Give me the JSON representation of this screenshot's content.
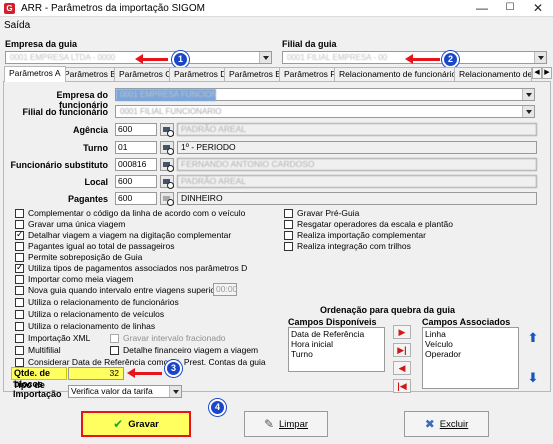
{
  "window": {
    "title": "ARR - Parâmetros da importação  SIGOM",
    "app_icon": "G",
    "minimize": "—",
    "maximize": "☐",
    "close": "✕"
  },
  "menu": {
    "item": "Saída"
  },
  "header": {
    "empresa_label": "Empresa da guia",
    "empresa_value": "0001 EMPRESA LTDA - 0000",
    "filial_label": "Filial  da guia",
    "filial_value": "0001 FILIAL EMPRESA - 00"
  },
  "tabs": [
    "Parâmetros A",
    "Parâmetros B",
    "Parâmetros C",
    "Parâmetros D",
    "Parâmetros E",
    "Parâmetros F",
    "Relacionamento de funcionários",
    "Relacionamento de v"
  ],
  "tab_scroll": {
    "left": "◀",
    "right": "▶"
  },
  "fields": {
    "empresa_funcionario_label": "Empresa do funcionário",
    "empresa_funcionario_value": "0001 EMPRESA FUNCIONARIO",
    "filial_funcionario_label": "Filial do funcionário",
    "filial_funcionario_value": "0001 FILIAL FUNCIONARIO",
    "agencia_label": "Agência",
    "agencia_value": "600",
    "agencia_desc": "PADRÃO AREAL",
    "turno_label": "Turno",
    "turno_value": "01",
    "turno_desc": "1º - PERIODO",
    "func_sub_label": "Funcionário substituto",
    "func_sub_value": "000816",
    "func_sub_desc": "FERNANDO ANTONIO CARDOSO",
    "local_label": "Local",
    "local_value": "600",
    "local_desc": "PADRÃO AREAL",
    "pagantes_label": "Pagantes",
    "pagantes_value": "600",
    "pagantes_desc": "DINHEIRO"
  },
  "checks_left": [
    {
      "label": "Complementar o  código da linha de acordo com o veículo",
      "checked": false
    },
    {
      "label": "Gravar uma única viagem",
      "checked": false
    },
    {
      "label": "Detalhar viagem a viagem na digitação complementar",
      "checked": true
    },
    {
      "label": "Pagantes igual ao total de passageiros",
      "checked": false
    },
    {
      "label": "Permite sobreposição de Guia",
      "checked": false
    },
    {
      "label": "Utiliza tipos de pagamentos associados nos parâmetros D",
      "checked": true
    },
    {
      "label": "Importar como meia viagem",
      "checked": false
    },
    {
      "label": "Nova guia quando intervalo entre viagens superior a",
      "checked": false
    },
    {
      "label": "Utiliza o relacionamento de funcionários",
      "checked": false
    },
    {
      "label": "Utiliza o relacionamento de veículos",
      "checked": false
    },
    {
      "label": "Utiliza o relacionamento de linhas",
      "checked": false
    },
    {
      "label": "Importação XML",
      "checked": false
    },
    {
      "label": "Multifilial",
      "checked": false
    },
    {
      "label": "Considerar Data de Referência como Dt. Prest. Contas da guia",
      "checked": false
    }
  ],
  "intervalo_value": "00:00",
  "checks_sub": [
    {
      "label": "Gravar intervalo fracionado",
      "checked": false
    },
    {
      "label": "Detalhe financeiro viagem a viagem",
      "checked": false
    }
  ],
  "checks_right": [
    {
      "label": "Gravar Pré-Guia",
      "checked": false
    },
    {
      "label": "Resgatar operadores da escala e plantão",
      "checked": false
    },
    {
      "label": "Realiza importação complementar",
      "checked": false
    },
    {
      "label": "Realiza integração com trilhos",
      "checked": false
    }
  ],
  "ordenacao": {
    "title": "Ordenação para quebra da guia",
    "disponiveis_label": "Campos Disponíveis",
    "disponiveis": [
      "Data de Referência",
      "Hora inicial",
      "Turno"
    ],
    "associados_label": "Campos Associados",
    "associados": [
      "Linha",
      "Veículo",
      "Operador"
    ],
    "btn_add": "▶",
    "btn_add_all": "▶|",
    "btn_remove": "◀",
    "btn_remove_all": "|◀",
    "btn_up": "⬆",
    "btn_down": "⬇"
  },
  "blocos": {
    "label": "Qtde. de blocos",
    "value": "32"
  },
  "tipo_importacao": {
    "label_1": "Tipo de",
    "label_2": "Importação",
    "value": "Verifica valor da tarifa"
  },
  "buttons": {
    "gravar": "Gravar",
    "limpar": "Limpar",
    "excluir": "Excluir"
  },
  "markers": [
    "1",
    "2",
    "3",
    "4"
  ],
  "colors": {
    "highlight_yellow": "#ffff60",
    "annotation_red": "#e8141c",
    "annotation_blue": "#1a47c8"
  }
}
